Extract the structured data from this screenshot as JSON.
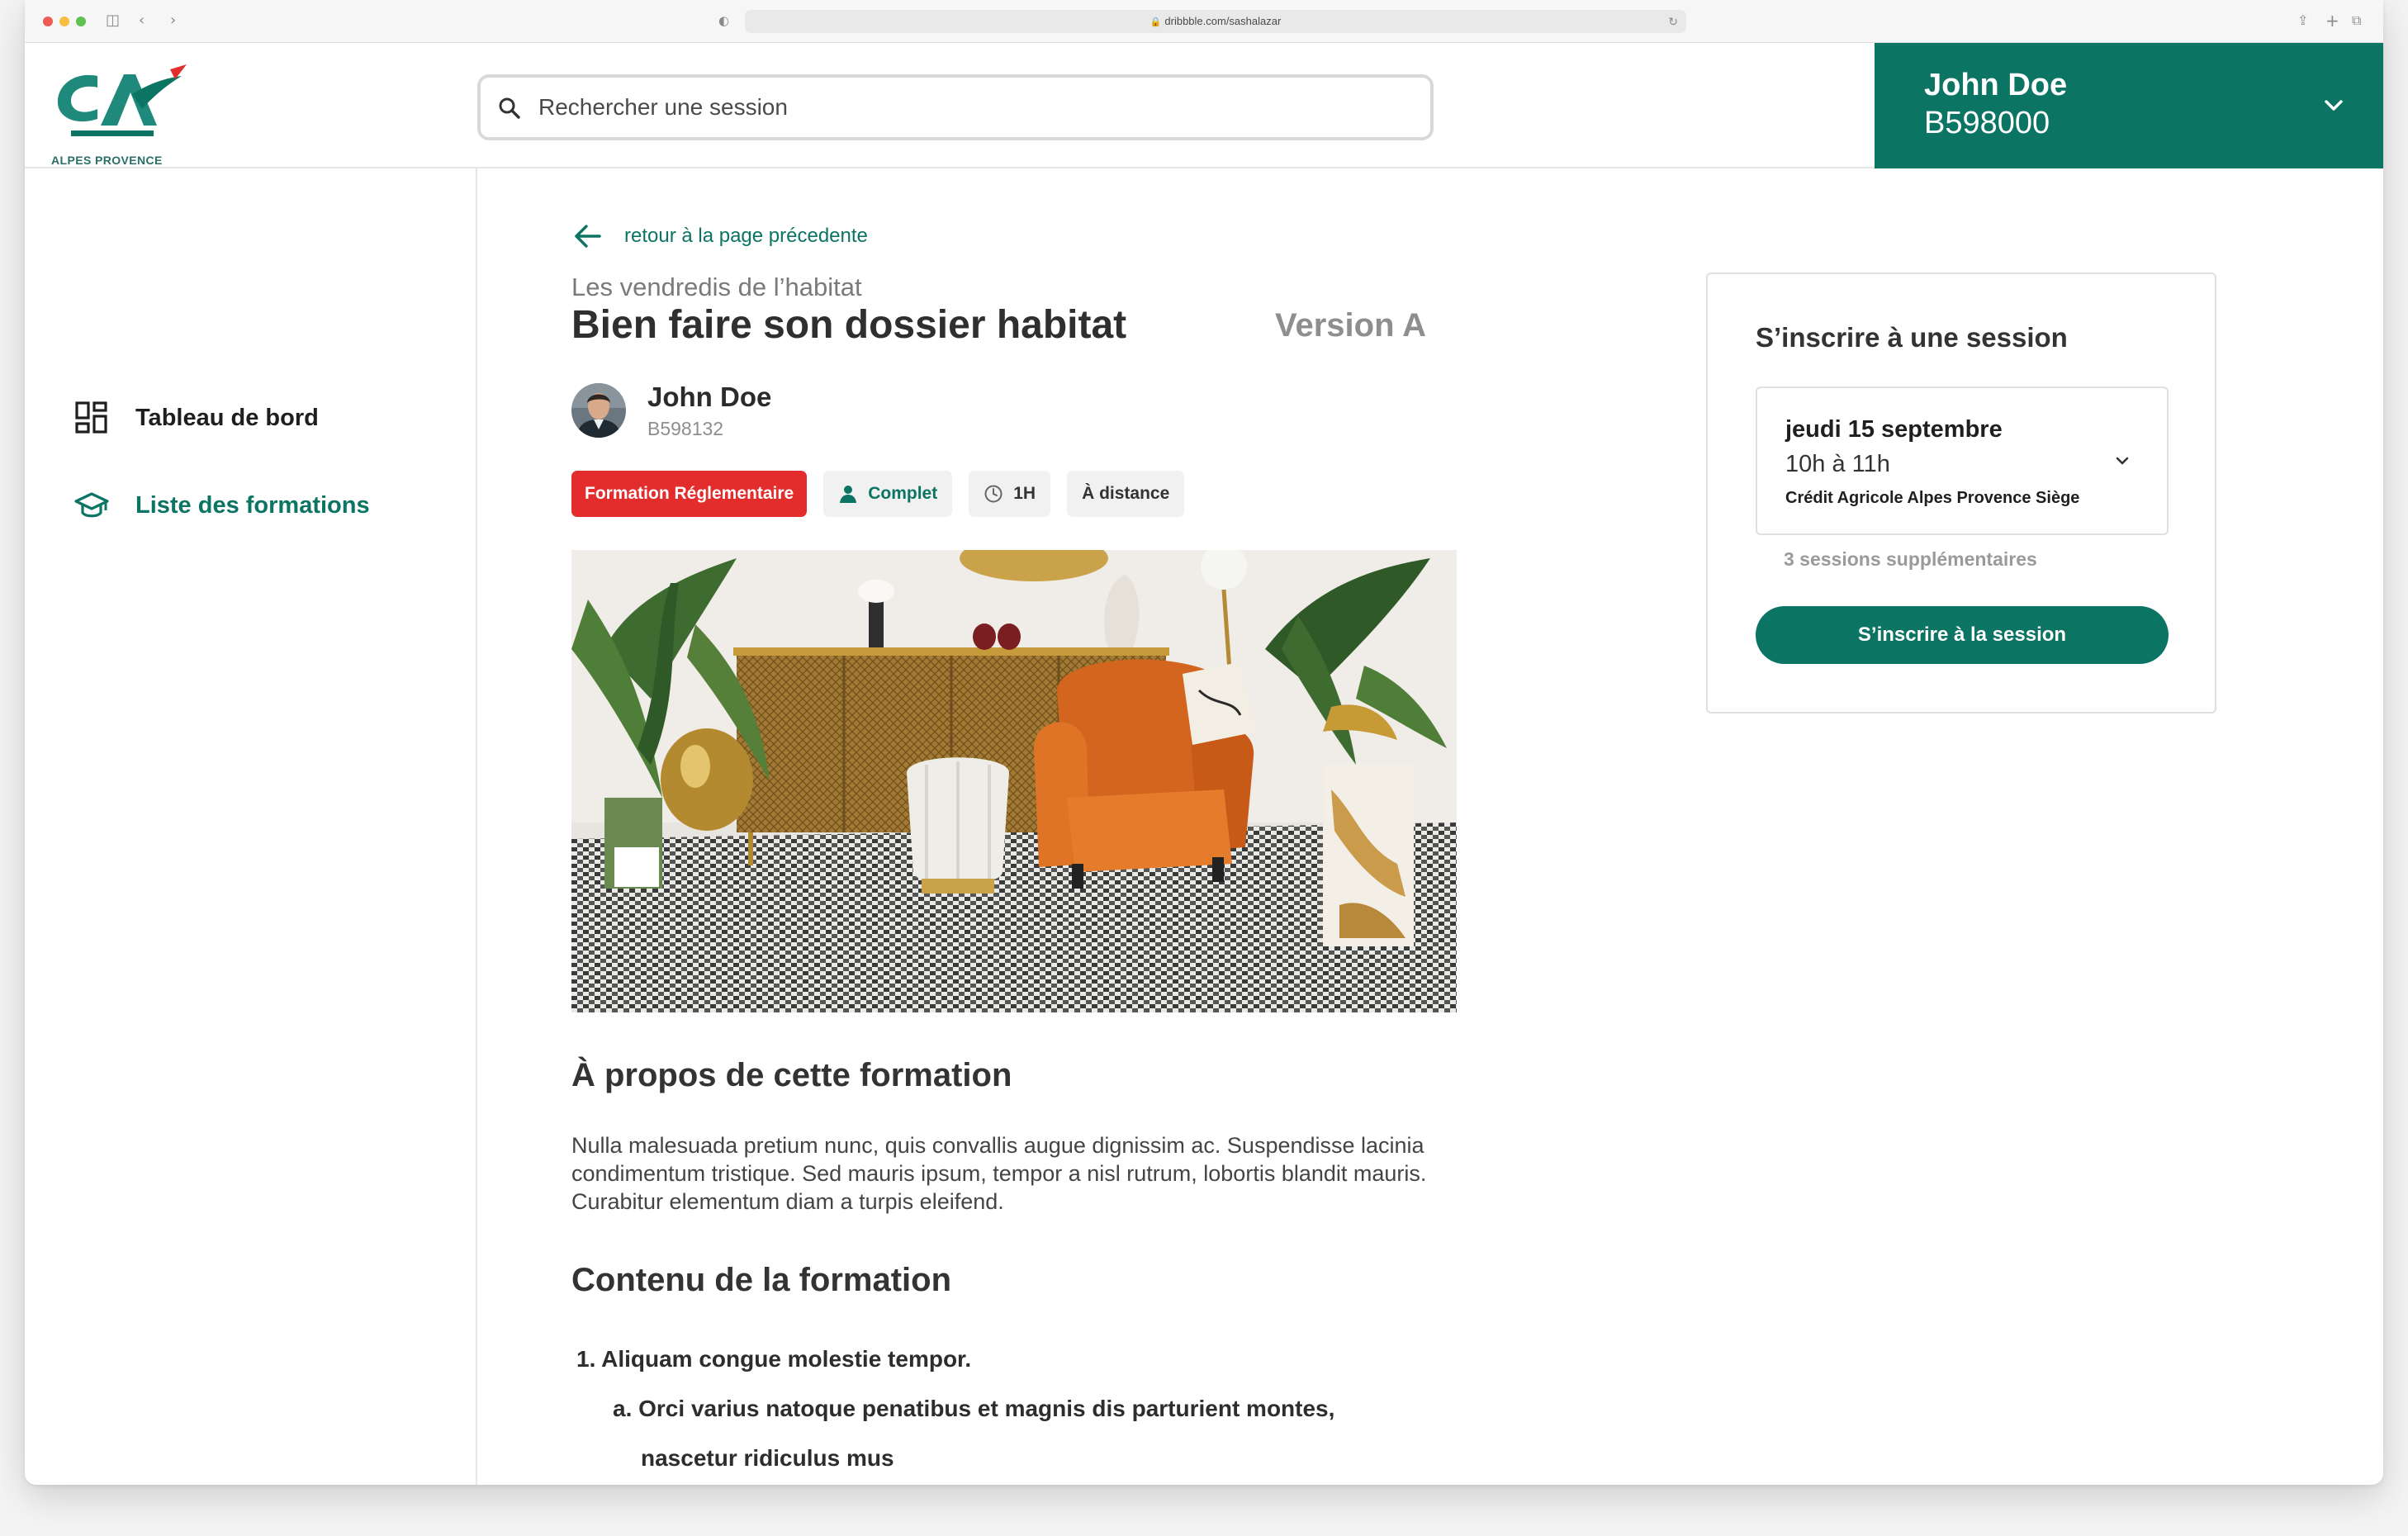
{
  "browser": {
    "url": "dribbble.com/sashalazar"
  },
  "header": {
    "logo_text": "ALPES PROVENCE",
    "search_placeholder": "Rechercher une session",
    "user": {
      "name": "John Doe",
      "id": "B598000"
    }
  },
  "sidebar": {
    "items": [
      {
        "label": "Tableau de bord",
        "icon": "dashboard-icon",
        "active": false
      },
      {
        "label": "Liste des formations",
        "icon": "graduation-cap-icon",
        "active": true
      }
    ]
  },
  "main": {
    "back_label": "retour à la page précedente",
    "kicker": "Les vendredis de l’habitat",
    "title": "Bien faire son dossier habitat",
    "version": "Version A",
    "author": {
      "name": "John Doe",
      "id": "B598132"
    },
    "tags": [
      {
        "label": "Formation Réglementaire",
        "style": "red"
      },
      {
        "label": "Complet",
        "icon": "person-icon",
        "style": "green"
      },
      {
        "label": "1H",
        "icon": "clock-icon"
      },
      {
        "label": "À distance"
      }
    ],
    "about_title": "À propos de cette formation",
    "about_text": "Nulla malesuada pretium nunc, quis convallis augue dignissim ac. Suspendisse lacinia condimentum tristique. Sed mauris ipsum, tempor a nisl rutrum, lobortis blandit mauris. Curabitur elementum diam a turpis eleifend.",
    "content_title": "Contenu de la formation",
    "content_list": [
      "1. Aliquam congue molestie tempor.",
      "a. Orci varius natoque penatibus et magnis dis parturient montes,",
      "nascetur ridiculus mus"
    ]
  },
  "session_card": {
    "title": "S’inscrire à une session",
    "selected": {
      "date": "jeudi 15 septembre",
      "time": "10h à 11h",
      "place": "Crédit Agricole Alpes Provence Siège"
    },
    "more": "3 sessions supplémentaires",
    "cta": "S’inscrire à la session"
  },
  "colors": {
    "brand_green": "#0b7463",
    "tag_red": "#e32d2d"
  }
}
